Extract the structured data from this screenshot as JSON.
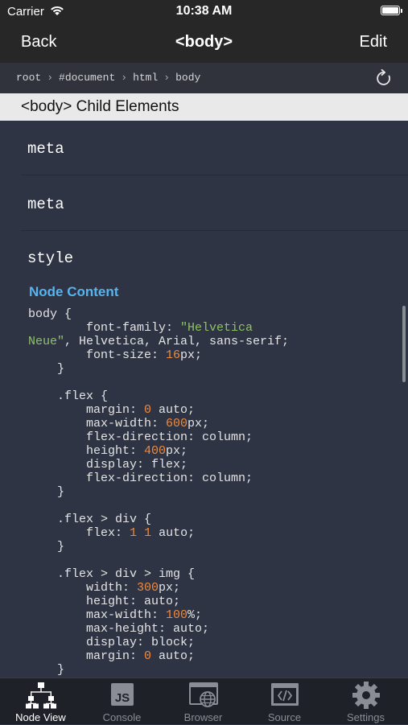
{
  "status_bar": {
    "carrier": "Carrier",
    "time": "10:38 AM"
  },
  "nav": {
    "back_label": "Back",
    "title": "<body>",
    "edit_label": "Edit"
  },
  "breadcrumb": [
    "root",
    "#document",
    "html",
    "body"
  ],
  "section_header": "<body> Child Elements",
  "child_elements": [
    "meta",
    "meta",
    "style"
  ],
  "node_content_label": "Node Content",
  "code_lines": [
    "body {",
    "        font-family: \"Helvetica",
    "Neue\", Helvetica, Arial, sans-serif;",
    "        font-size: 16px;",
    "    }",
    "",
    "    .flex {",
    "        margin: 0 auto;",
    "        max-width: 600px;",
    "        flex-direction: column;",
    "        height: 400px;",
    "        display: flex;",
    "        flex-direction: column;",
    "    }",
    "",
    "    .flex > div {",
    "        flex: 1 1 auto;",
    "    }",
    "",
    "    .flex > div > img {",
    "        width: 300px;",
    "        height: auto;",
    "        max-width: 100%;",
    "        max-height: auto;",
    "        display: block;",
    "        margin: 0 auto;",
    "    }"
  ],
  "tabs": [
    {
      "label": "Node View",
      "icon": "hierarchy-icon",
      "active": true
    },
    {
      "label": "Console",
      "icon": "js-console-icon",
      "active": false
    },
    {
      "label": "Browser",
      "icon": "browser-globe-icon",
      "active": false
    },
    {
      "label": "Source",
      "icon": "source-code-icon",
      "active": false
    },
    {
      "label": "Settings",
      "icon": "gear-icon",
      "active": false
    }
  ],
  "colors": {
    "background": "#2f3445",
    "bars": "#272727",
    "accent": "#56b4ef",
    "string": "#8fc16a",
    "number": "#ef8a3c"
  }
}
